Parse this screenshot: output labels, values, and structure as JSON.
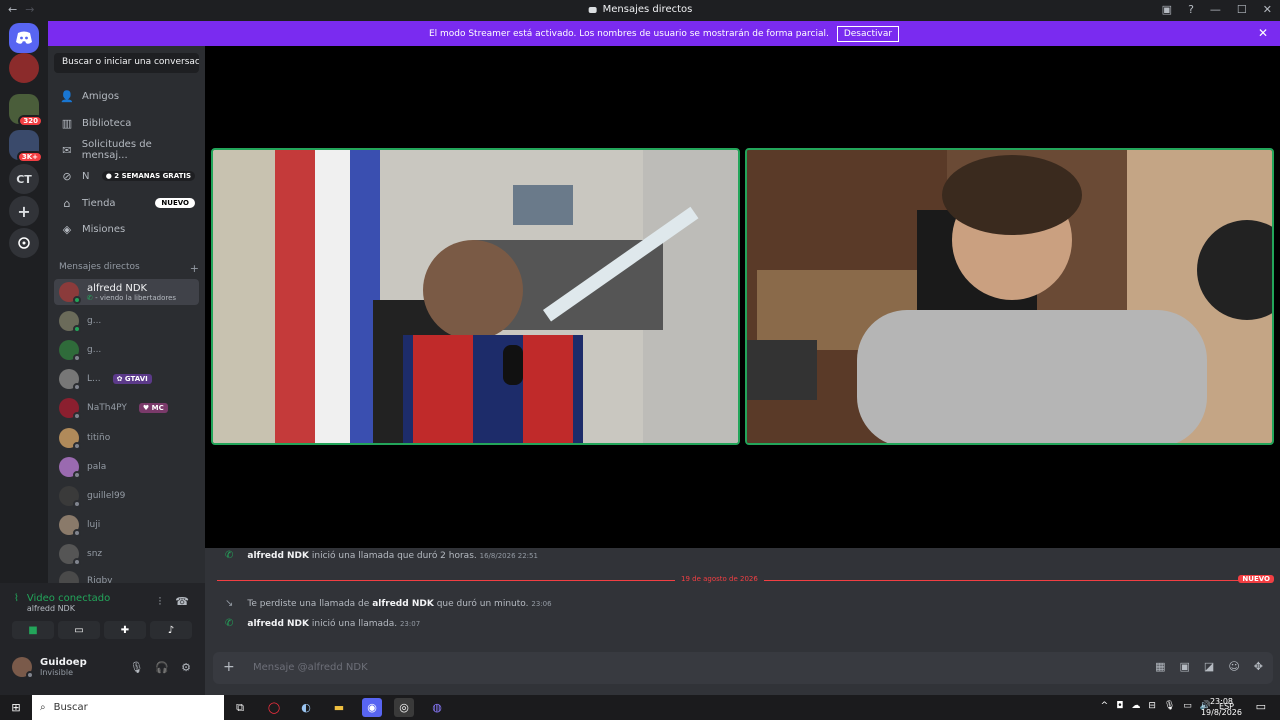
{
  "window": {
    "title": "Mensajes directos",
    "back_icon": "←",
    "forward_icon": "→"
  },
  "streamer_banner": {
    "text": "El modo Streamer está activado. Los nombres de usuario se mostrarán de forma parcial.",
    "button": "Desactivar",
    "close": "✕"
  },
  "servers": {
    "ct_label": "CT",
    "badge_1": "320",
    "badge_2": "3K+"
  },
  "sidebar": {
    "search": "Buscar o iniciar una conversac...",
    "nav": [
      {
        "label": "Amigos",
        "icon": "friends-icon"
      },
      {
        "label": "Biblioteca",
        "icon": "library-icon"
      },
      {
        "label": "Solicitudes de mensaj...",
        "icon": "inbox-icon"
      },
      {
        "label": "N",
        "icon": "nitro-icon",
        "badge": "2 SEMANAS GRATIS"
      },
      {
        "label": "Tienda",
        "icon": "shop-icon",
        "badge": "NUEVO"
      },
      {
        "label": "Misiones",
        "icon": "quests-icon"
      }
    ],
    "dm_header": "Mensajes directos",
    "dm_add": "+",
    "dms": [
      {
        "name": "alfredd NDK",
        "sub": "- viendo la libertadores",
        "active": true,
        "online": true
      },
      {
        "name": "g...",
        "online": true
      },
      {
        "name": "g...",
        "online": false
      },
      {
        "name": "L...",
        "tag": "GTAVI",
        "online": false
      },
      {
        "name": "NaTh4PY",
        "tag": "MC",
        "online": false
      },
      {
        "name": "titiño",
        "online": false
      },
      {
        "name": "pala",
        "online": false
      },
      {
        "name": "guillel99",
        "online": false
      },
      {
        "name": "luji",
        "online": false
      },
      {
        "name": "snz",
        "online": false
      },
      {
        "name": "Rigby",
        "online": false
      }
    ]
  },
  "voice_panel": {
    "status": "Video conectado",
    "channel": "alfredd NDK",
    "user_name": "Guidoep",
    "user_status": "Invisible"
  },
  "chat": {
    "messages": [
      {
        "name": "alfredd NDK",
        "text": "inició una llamada que duró 2 horas.",
        "time": "16/8/2026 22:51"
      },
      {
        "name": "alfredd NDK",
        "prefix": "Te perdiste una llamada de",
        "text": "que duró un minuto.",
        "time": "23:06"
      },
      {
        "name": "alfredd NDK",
        "text": "inició una llamada.",
        "time": "23:07"
      }
    ],
    "divider_date": "19 de agosto de 2026",
    "divider_new": "NUEVO",
    "placeholder": "Mensaje @alfredd NDK"
  },
  "taskbar": {
    "search": "Buscar",
    "lang": "ESP",
    "time": "23:08",
    "date": "19/8/2026"
  }
}
